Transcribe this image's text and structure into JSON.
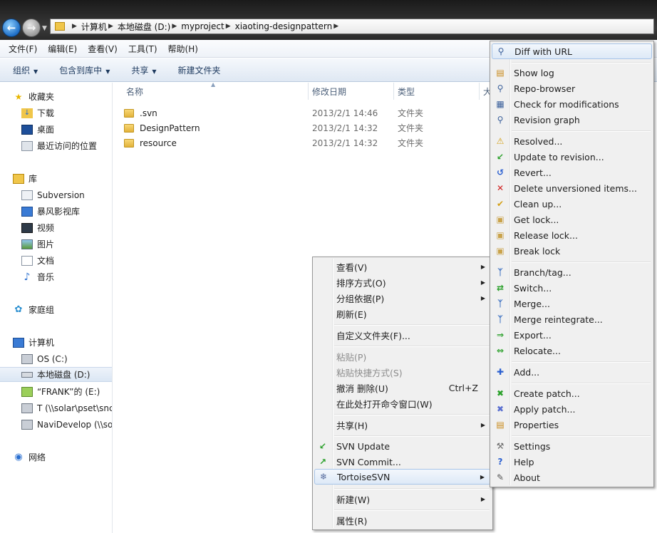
{
  "window": {
    "breadcrumbs": [
      "计算机",
      "本地磁盘 (D:)",
      "myproject",
      "xiaoting-designpattern"
    ]
  },
  "menubar": {
    "items": [
      "文件(F)",
      "编辑(E)",
      "查看(V)",
      "工具(T)",
      "帮助(H)"
    ]
  },
  "toolbar": {
    "organize": "组织",
    "include_library": "包含到库中",
    "share": "共享",
    "new_folder": "新建文件夹"
  },
  "nav": {
    "favorites": "收藏夹",
    "downloads": "下载",
    "desktop": "桌面",
    "recent": "最近访问的位置",
    "libraries": "库",
    "subversion": "Subversion",
    "storm_lib": "暴风影视库",
    "videos": "视频",
    "pictures": "图片",
    "documents": "文档",
    "music": "音乐",
    "homegroup": "家庭组",
    "computer": "计算机",
    "drive_c": "OS (C:)",
    "drive_d": "本地磁盘 (D:)",
    "drive_e": "“FRANK”的 (E:)",
    "drive_t": "T (\\\\solar\\pset\\snc",
    "drive_navi": "NaviDevelop (\\\\so",
    "network": "网络"
  },
  "columns": {
    "name": "名称",
    "date": "修改日期",
    "type": "类型",
    "more": "大"
  },
  "files": [
    {
      "name": ".svn",
      "date": "2013/2/1 14:46",
      "type": "文件夹"
    },
    {
      "name": "DesignPattern",
      "date": "2013/2/1 14:32",
      "type": "文件夹"
    },
    {
      "name": "resource",
      "date": "2013/2/1 14:32",
      "type": "文件夹"
    }
  ],
  "context_menu": {
    "view": "查看(V)",
    "sort": "排序方式(O)",
    "group": "分组依据(P)",
    "refresh": "刷新(E)",
    "customize": "自定义文件夹(F)...",
    "paste": "粘贴(P)",
    "paste_shortcut": "粘贴快捷方式(S)",
    "undo_delete": "撤消 删除(U)",
    "undo_shortcut": "Ctrl+Z",
    "open_cmd": "在此处打开命令窗口(W)",
    "share": "共享(H)",
    "svn_update": "SVN Update",
    "svn_commit": "SVN Commit...",
    "tortoisesvn": "TortoiseSVN",
    "new": "新建(W)",
    "properties": "属性(R)"
  },
  "svn_menu": {
    "diff_url": "Diff with URL",
    "show_log": "Show log",
    "repo_browser": "Repo-browser",
    "check_mod": "Check for modifications",
    "revision_graph": "Revision graph",
    "resolved": "Resolved...",
    "update_rev": "Update to revision...",
    "revert": "Revert...",
    "delete_unversioned": "Delete unversioned items...",
    "cleanup": "Clean up...",
    "get_lock": "Get lock...",
    "release_lock": "Release lock...",
    "break_lock": "Break lock",
    "branch_tag": "Branch/tag...",
    "switch": "Switch...",
    "merge": "Merge...",
    "merge_reintegrate": "Merge reintegrate...",
    "export": "Export...",
    "relocate": "Relocate...",
    "add": "Add...",
    "create_patch": "Create patch...",
    "apply_patch": "Apply patch...",
    "properties": "Properties",
    "settings": "Settings",
    "help": "Help",
    "about": "About"
  }
}
